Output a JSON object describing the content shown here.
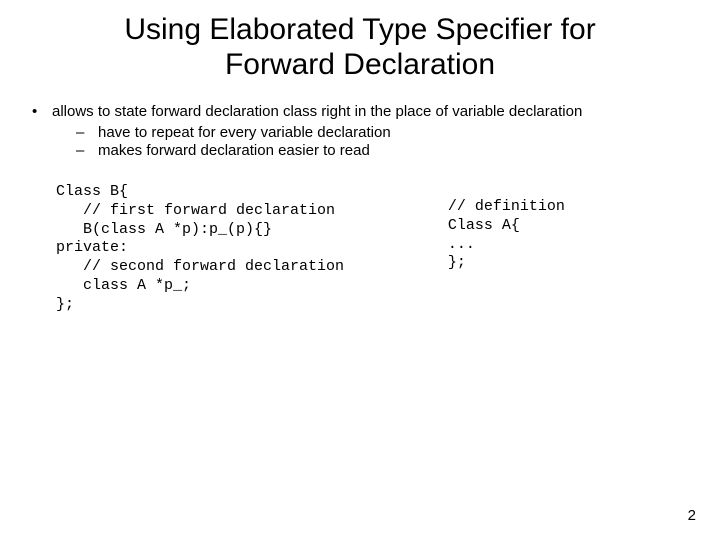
{
  "title_line1": "Using Elaborated Type Specifier for",
  "title_line2": "Forward Declaration",
  "bullet": {
    "mark": "•",
    "text": "allows to state forward declaration class right in the place of variable declaration",
    "subs": [
      {
        "mark": "–",
        "text": "have to repeat for every variable declaration"
      },
      {
        "mark": "–",
        "text": "makes forward declaration easier to read"
      }
    ]
  },
  "code_left": "Class B{\n   // first forward declaration\n   B(class A *p):p_(p){}\nprivate:\n   // second forward declaration\n   class A *p_;\n};",
  "code_right": "// definition\nClass A{\n...\n};",
  "page_number": "2"
}
